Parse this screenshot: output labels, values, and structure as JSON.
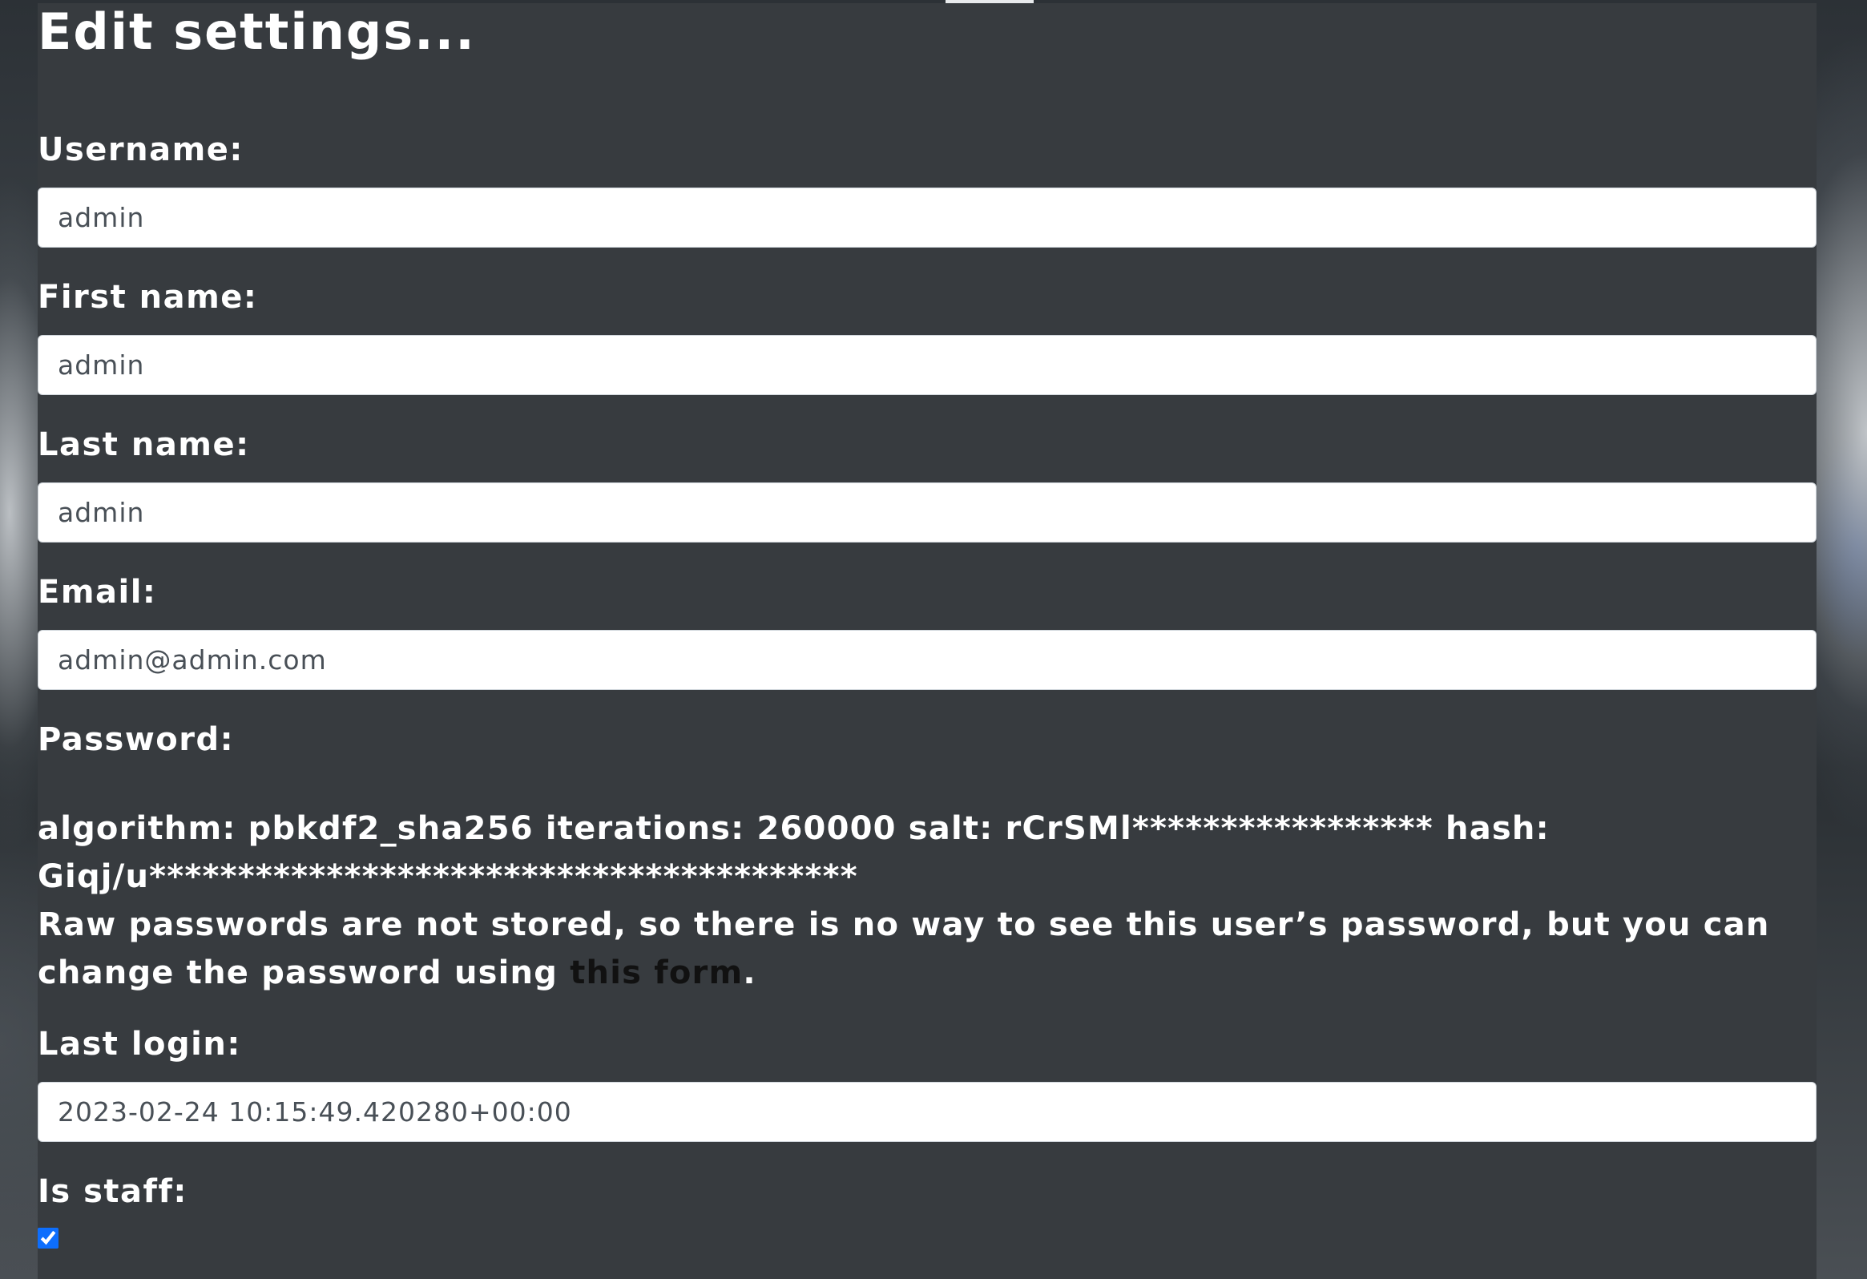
{
  "page": {
    "title": "Edit settings..."
  },
  "form": {
    "username": {
      "label": "Username:",
      "value": "admin"
    },
    "first_name": {
      "label": "First name:",
      "value": "admin"
    },
    "last_name": {
      "label": "Last name:",
      "value": "admin"
    },
    "email": {
      "label": "Email:",
      "value": "admin@admin.com"
    },
    "password": {
      "label": "Password:",
      "info": "algorithm: pbkdf2_sha256 iterations: 260000 salt: rCrSMl***************** hash: Giqj/u****************************************",
      "help_prefix": "Raw passwords are not stored, so there is no way to see this user’s password, but you can change the password using ",
      "help_link": "this form",
      "help_suffix": "."
    },
    "last_login": {
      "label": "Last login:",
      "value": "2023-02-24 10:15:49.420280+00:00"
    },
    "is_staff": {
      "label": "Is staff:",
      "checked": true
    }
  },
  "colors": {
    "panel_bg": "#373b3f",
    "text": "#ffffff",
    "input_text": "#495057",
    "link": "#111111",
    "checkbox_accent": "#0d6efd"
  }
}
